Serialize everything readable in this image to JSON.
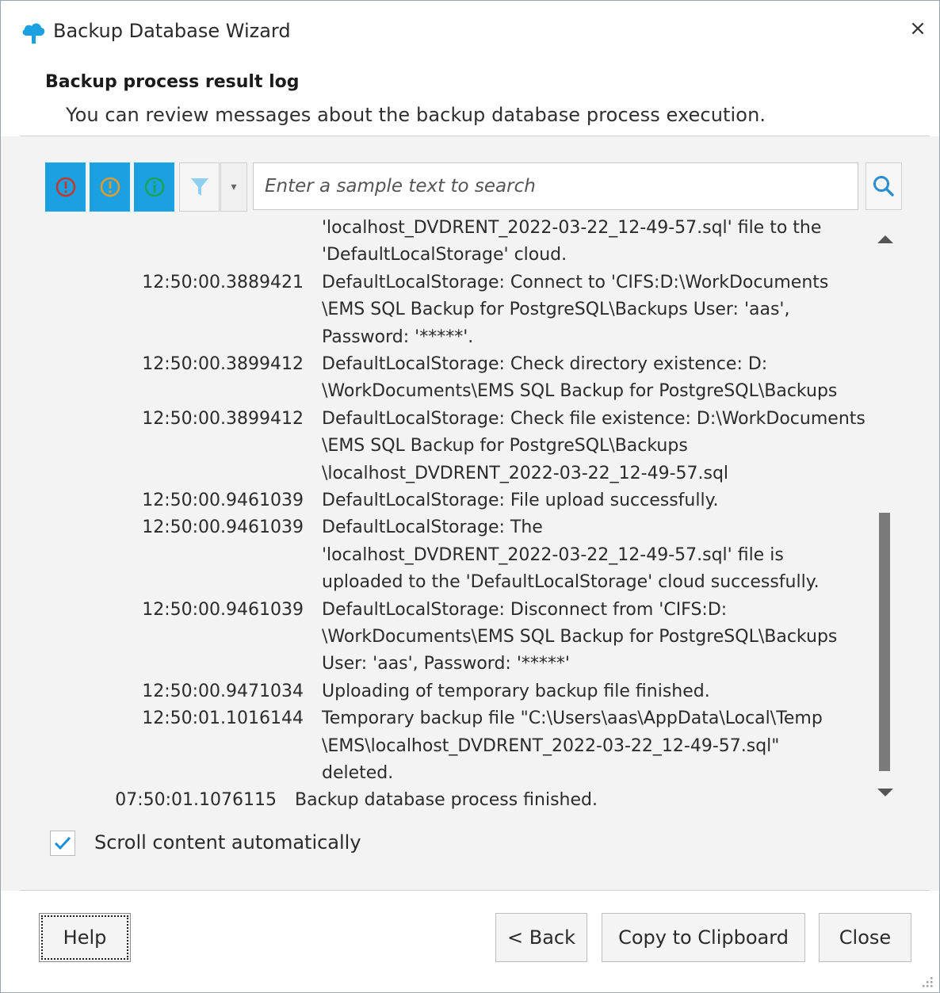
{
  "window": {
    "title": "Backup Database Wizard",
    "close_glyph": "×"
  },
  "header": {
    "title": "Backup process result log",
    "subtitle": "You can review messages about the backup database process execution."
  },
  "toolbar": {
    "filters": [
      {
        "name": "errors",
        "icon": "error-icon",
        "color": "#c0392b"
      },
      {
        "name": "warnings",
        "icon": "warning-icon",
        "color": "#e09b2d"
      },
      {
        "name": "info",
        "icon": "info-icon",
        "color": "#1aa35a"
      }
    ],
    "filter_icon": "funnel-icon",
    "dropdown_glyph": "▾",
    "search_placeholder": "Enter a sample text to search",
    "search_value": ""
  },
  "log": {
    "entries": [
      {
        "time": "",
        "lines": [
          "'localhost_DVDRENT_2022-03-22_12-49-57.sql' file to the",
          "'DefaultLocalStorage' cloud."
        ]
      },
      {
        "time": "12:50:00.3889421",
        "lines": [
          "DefaultLocalStorage: Connect to 'CIFS:D:\\WorkDocuments",
          "\\EMS SQL Backup for PostgreSQL\\Backups User: 'aas',",
          "Password: '*****'."
        ]
      },
      {
        "time": "12:50:00.3899412",
        "lines": [
          "DefaultLocalStorage: Check directory existence: D:",
          "\\WorkDocuments\\EMS SQL Backup for PostgreSQL\\Backups"
        ]
      },
      {
        "time": "12:50:00.3899412",
        "lines": [
          "DefaultLocalStorage: Check file existence: D:\\WorkDocuments",
          "\\EMS SQL Backup for PostgreSQL\\Backups",
          "\\localhost_DVDRENT_2022-03-22_12-49-57.sql"
        ]
      },
      {
        "time": "12:50:00.9461039",
        "lines": [
          "DefaultLocalStorage: File upload successfully."
        ]
      },
      {
        "time": "12:50:00.9461039",
        "lines": [
          "DefaultLocalStorage: The",
          "'localhost_DVDRENT_2022-03-22_12-49-57.sql' file is",
          "uploaded to the 'DefaultLocalStorage' cloud successfully."
        ]
      },
      {
        "time": "12:50:00.9461039",
        "lines": [
          "DefaultLocalStorage: Disconnect from 'CIFS:D:",
          "\\WorkDocuments\\EMS SQL Backup for PostgreSQL\\Backups",
          "User: 'aas', Password: '*****'"
        ]
      },
      {
        "time": "12:50:00.9471034",
        "lines": [
          "Uploading of temporary backup file finished."
        ]
      },
      {
        "time": "12:50:01.1016144",
        "lines": [
          "Temporary backup file \"C:\\Users\\aas\\AppData\\Local\\Temp",
          "\\EMS\\localhost_DVDRENT_2022-03-22_12-49-57.sql\"",
          "deleted."
        ]
      }
    ],
    "final": {
      "time": "07:50:01.1076115",
      "text": "Backup database process finished."
    }
  },
  "options": {
    "scroll_auto_label": "Scroll content automatically",
    "scroll_auto_checked": true
  },
  "buttons": {
    "help": "Help",
    "back": "< Back",
    "copy": "Copy to Clipboard",
    "close": "Close"
  },
  "colors": {
    "accent": "#1ba1e2"
  }
}
